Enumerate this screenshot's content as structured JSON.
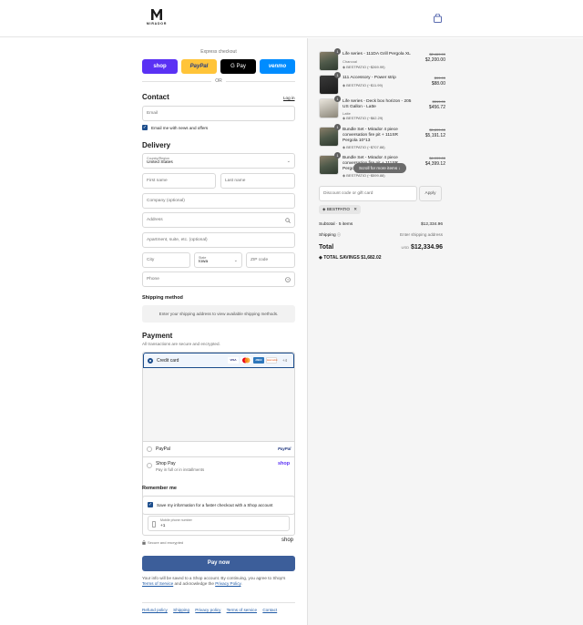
{
  "header": {
    "brand": "MIRADOR",
    "bag_icon": "shopping-bag-icon"
  },
  "express": {
    "title": "Express checkout",
    "buttons": [
      {
        "label": "shop",
        "color": "#5a31f4"
      },
      {
        "label": "PayPal",
        "color": "#ffc439"
      },
      {
        "label": "G Pay",
        "color": "#000000"
      },
      {
        "label": "venmo",
        "color": "#008cff"
      }
    ],
    "or": "OR"
  },
  "contact": {
    "title": "Contact",
    "login": "Log in",
    "email_placeholder": "Email",
    "news_label": "Email me with news and offers"
  },
  "delivery": {
    "title": "Delivery",
    "country_label": "Country/Region",
    "country_value": "United States",
    "first_name": "First name",
    "last_name": "Last name",
    "company": "Company (optional)",
    "address": "Address",
    "apartment": "Apartment, suite, etc. (optional)",
    "city": "City",
    "state_label": "State",
    "state_value": "Iowa",
    "zip": "ZIP code",
    "phone": "Phone"
  },
  "shipping_method": {
    "title": "Shipping method",
    "notice": "Enter your shipping address to view available shipping methods."
  },
  "payment": {
    "title": "Payment",
    "subtitle": "All transactions are secure and encrypted.",
    "credit_card": "Credit card",
    "cards": [
      "VISA",
      "MC",
      "AMEX",
      "DISCOVER"
    ],
    "more_cards": "+4",
    "paypal": "PayPal",
    "paypal_logo": "PayPal",
    "shop_pay": "Shop Pay",
    "shop_pay_sub": "Pay in full or in installments",
    "shop_logo": "shop"
  },
  "remember": {
    "title": "Remember me",
    "save_label": "Save my information for a faster checkout with a Shop account",
    "mobile_label": "Mobile phone number",
    "mobile_value": "+1",
    "secure": "Secure and encrypted",
    "shop_logo": "shop"
  },
  "pay_now": "Pay now",
  "legal": {
    "text1": "Your info will be saved to a Shop account. By continuing, you agree to Shop's",
    "tos": "Terms of Service",
    "text2": "and acknowledge the",
    "privacy": "Privacy Policy",
    "end": "."
  },
  "footer_links": [
    "Refund policy",
    "Shipping",
    "Privacy policy",
    "Terms of service",
    "Contact"
  ],
  "cart": {
    "items": [
      {
        "qty": "1",
        "name": "Life series - 111DA Grill Pergola XL",
        "variant": "Charcoal",
        "discount": "BESTPATIO (−$269.99)",
        "old_price": "$2,469.99",
        "price": "$2,200.00"
      },
      {
        "qty": "1",
        "name": "111 Accessory - Power strip",
        "variant": "",
        "discount": "BESTPATIO (−$11.99)",
        "old_price": "$99.99",
        "price": "$88.00"
      },
      {
        "qty": "1",
        "name": "Life series - Deck box horizon - 205 US Gallon - Latte",
        "variant": "Latte",
        "discount": "BESTPATIO (−$62.29)",
        "old_price": "$519.01",
        "price": "$456.72"
      },
      {
        "qty": "1",
        "name": "Bundle Set - Mirador 4 piece conversation fire pit + 111SR Pergola 10*13",
        "variant": "",
        "discount": "BESTPATIO (−$707.88)",
        "old_price": "$5,899.00",
        "price": "$5,191.12"
      },
      {
        "qty": "1",
        "name": "Bundle Set - Mirador 4 piece conversation fire pit + 111SR Pergola",
        "variant": "",
        "discount": "BESTPATIO (−$599.88)",
        "old_price": "$4,999.00",
        "price": "$4,399.12"
      }
    ],
    "scroll_hint": "Scroll for more items",
    "discount_placeholder": "Discount code or gift card",
    "apply": "Apply",
    "applied_code": "BESTPATIO",
    "subtotal_label": "Subtotal · 5 items",
    "subtotal_value": "$12,334.96",
    "shipping_label": "Shipping",
    "shipping_value": "Enter shipping address",
    "total_label": "Total",
    "currency": "USD",
    "total_value": "$12,334.96",
    "savings_label": "TOTAL SAVINGS",
    "savings_value": "$1,682.02"
  }
}
